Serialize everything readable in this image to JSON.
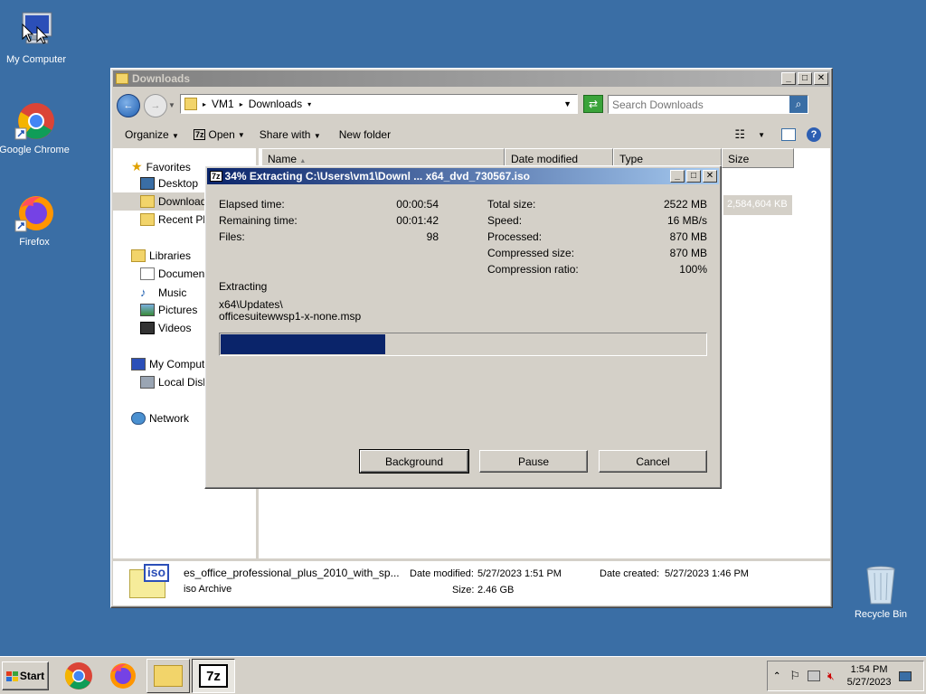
{
  "desktop": {
    "icons": [
      {
        "label": "My Computer",
        "icon": "my-computer-icon"
      },
      {
        "label": "Google Chrome",
        "icon": "chrome-icon"
      },
      {
        "label": "Firefox",
        "icon": "firefox-icon"
      },
      {
        "label": "Recycle Bin",
        "icon": "recycle-bin-icon"
      }
    ]
  },
  "explorer": {
    "title": "Downloads",
    "address": {
      "root": "VM1",
      "folder": "Downloads"
    },
    "search_placeholder": "Search Downloads",
    "toolbar": {
      "organize": "Organize",
      "open": "Open",
      "share_with": "Share with",
      "new_folder": "New folder"
    },
    "columns": {
      "name": "Name",
      "date_modified": "Date modified",
      "type": "Type",
      "size": "Size"
    },
    "nav": {
      "favorites": "Favorites",
      "desktop": "Desktop",
      "downloads": "Downloads",
      "recent": "Recent Pla",
      "libraries": "Libraries",
      "documents": "Documents",
      "music": "Music",
      "pictures": "Pictures",
      "videos": "Videos",
      "computer": "My Compute",
      "local_disk": "Local Disk",
      "network": "Network"
    },
    "file_size_cell": "2,584,604 KB",
    "details": {
      "filename": "es_office_professional_plus_2010_with_sp...",
      "filetype": "iso Archive",
      "date_modified_label": "Date modified:",
      "date_modified": "5/27/2023 1:51 PM",
      "date_created_label": "Date created:",
      "date_created": "5/27/2023 1:46 PM",
      "size_label": "Size:",
      "size": "2.46 GB",
      "thumb_text": "iso"
    }
  },
  "extract_dialog": {
    "title": "34% Extracting C:\\Users\\vm1\\Downl ... x64_dvd_730567.iso",
    "app_badge": "7z",
    "elapsed_label": "Elapsed time:",
    "elapsed": "00:00:54",
    "remaining_label": "Remaining time:",
    "remaining": "00:01:42",
    "files_label": "Files:",
    "files": "98",
    "total_label": "Total size:",
    "total": "2522 MB",
    "speed_label": "Speed:",
    "speed": "16 MB/s",
    "processed_label": "Processed:",
    "processed": "870 MB",
    "compressed_label": "Compressed size:",
    "compressed": "870 MB",
    "ratio_label": "Compression ratio:",
    "ratio": "100%",
    "action_label": "Extracting",
    "path_line1": "x64\\Updates\\",
    "path_line2": "officesuitewwsp1-x-none.msp",
    "progress_fraction": 0.34,
    "buttons": {
      "background": "Background",
      "pause": "Pause",
      "cancel": "Cancel"
    }
  },
  "taskbar": {
    "start": "Start",
    "clock_time": "1:54 PM",
    "clock_date": "5/27/2023",
    "seven_zip_label": "7z"
  }
}
